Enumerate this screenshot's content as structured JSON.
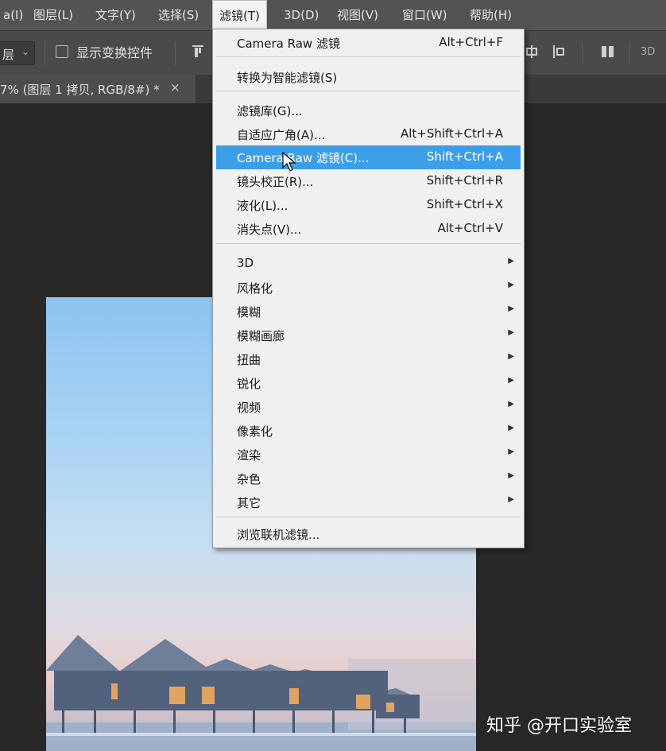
{
  "menubar": {
    "items": [
      "a(I)",
      "图层(L)",
      "文字(Y)",
      "选择(S)",
      "滤镜(T)",
      "3D(D)",
      "视图(V)",
      "窗口(W)",
      "帮助(H)"
    ]
  },
  "options": {
    "layer_select": "层",
    "show_transform": "显示变换控件",
    "label_3d": "3D"
  },
  "doc_tab": {
    "title": "7% (图层 1 拷贝, RGB/8#) *",
    "close": "×"
  },
  "filter_menu": {
    "last_filter": {
      "label": "Camera Raw 滤镜",
      "shortcut": "Alt+Ctrl+F"
    },
    "smart": {
      "label": "转换为智能滤镜(S)"
    },
    "group1": [
      {
        "label": "滤镜库(G)...",
        "shortcut": ""
      },
      {
        "label": "自适应广角(A)...",
        "shortcut": "Alt+Shift+Ctrl+A"
      },
      {
        "label": "Camera Raw 滤镜(C)...",
        "shortcut": "Shift+Ctrl+A"
      },
      {
        "label": "镜头校正(R)...",
        "shortcut": "Shift+Ctrl+R"
      },
      {
        "label": "液化(L)...",
        "shortcut": "Shift+Ctrl+X"
      },
      {
        "label": "消失点(V)...",
        "shortcut": "Alt+Ctrl+V"
      }
    ],
    "submenus": [
      "3D",
      "风格化",
      "模糊",
      "模糊画廊",
      "扭曲",
      "锐化",
      "视频",
      "像素化",
      "渲染",
      "杂色",
      "其它"
    ],
    "browse": "浏览联机滤镜..."
  },
  "watermark": "知乎 @开口实验室",
  "colors": {
    "highlight": "#3d9ee8",
    "menu_bg": "#f0f0f0",
    "menubar_bg": "#535353"
  }
}
